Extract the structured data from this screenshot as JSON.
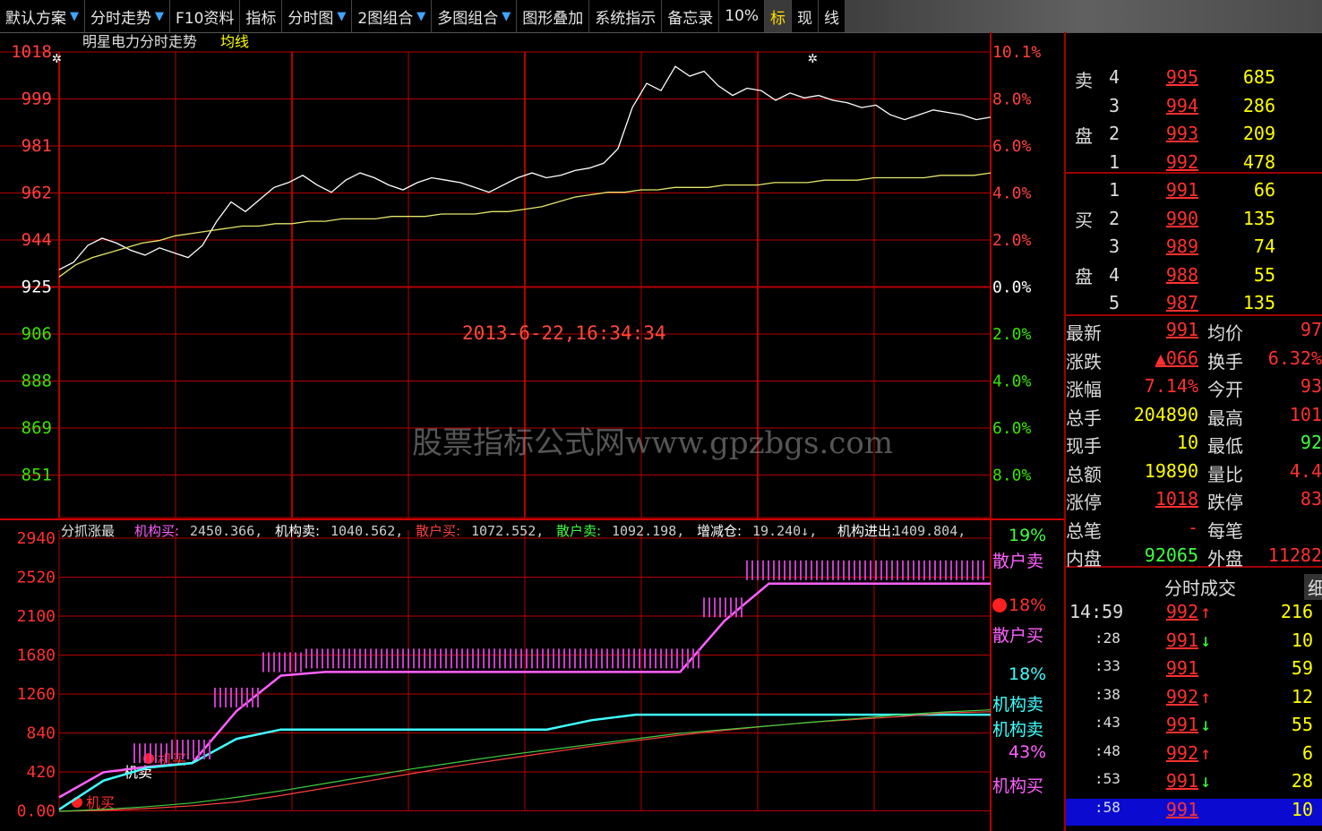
{
  "toolbar": {
    "items": [
      {
        "label": "默认方案",
        "arrow": true
      },
      {
        "label": "分时走势",
        "arrow": true
      },
      {
        "label": "F10资料",
        "arrow": false
      },
      {
        "label": "指标",
        "arrow": false
      },
      {
        "label": "分时图",
        "arrow": true
      },
      {
        "label": "2图组合",
        "arrow": true
      },
      {
        "label": "多图组合",
        "arrow": true
      },
      {
        "label": "图形叠加",
        "arrow": false
      },
      {
        "label": "系统指示",
        "arrow": false
      },
      {
        "label": "备忘录",
        "arrow": false
      },
      {
        "label": "10%",
        "arrow": false
      },
      {
        "label": "标",
        "arrow": false,
        "highlight": true
      },
      {
        "label": "现",
        "arrow": false
      },
      {
        "label": "线",
        "arrow": false
      }
    ]
  },
  "chart_header": {
    "title": "明星电力分时走势",
    "series_label": "均线"
  },
  "price_axis": {
    "left": [
      "1018",
      "999",
      "981",
      "962",
      "944",
      "925",
      "906",
      "888",
      "869",
      "851"
    ],
    "right": [
      "10.1%",
      "8.0%",
      "6.0%",
      "4.0%",
      "2.0%",
      "0.0%",
      "2.0%",
      "4.0%",
      "6.0%",
      "8.0%"
    ]
  },
  "timestamp": "2013-6-22,16:34:34",
  "watermark": "股票指标公式网www.gpzbgs.com",
  "indicator_header": {
    "name": "分抓涨最",
    "items": [
      {
        "label": "机构买:",
        "value": "2450.366,"
      },
      {
        "label": "机构卖:",
        "value": "1040.562,"
      },
      {
        "label": "散户买:",
        "value": "1072.552,"
      },
      {
        "label": "散户卖:",
        "value": "1092.198,"
      },
      {
        "label": "增减仓:",
        "value": "19.240↓,"
      },
      {
        "label": "机构进出:",
        "value": "1409.804,"
      }
    ]
  },
  "indicator_axis": [
    "2940",
    "2520",
    "2100",
    "1680",
    "1260",
    "840",
    "420",
    "0.00"
  ],
  "indicator_side": {
    "p1": "19%",
    "l1": "散户卖",
    "p2": "18%",
    "l2": "机构买",
    "l3": "散户买",
    "p3": "18%",
    "l4": "机构卖",
    "l5": "机构卖",
    "p4": "43%",
    "l6": "机构买"
  },
  "chart_labels": {
    "buy1": "机买",
    "sell1": "机卖",
    "buy2": "机买"
  },
  "orderbook": {
    "sell_label_1": "卖",
    "sell_label_2": "盘",
    "buy_label_1": "买",
    "buy_label_2": "盘",
    "sells": [
      {
        "level": "4",
        "price": "995",
        "vol": "685"
      },
      {
        "level": "3",
        "price": "994",
        "vol": "286"
      },
      {
        "level": "2",
        "price": "993",
        "vol": "209"
      },
      {
        "level": "1",
        "price": "992",
        "vol": "478"
      }
    ],
    "buys": [
      {
        "level": "1",
        "price": "991",
        "vol": "66"
      },
      {
        "level": "2",
        "price": "990",
        "vol": "135"
      },
      {
        "level": "3",
        "price": "989",
        "vol": "74"
      },
      {
        "level": "4",
        "price": "988",
        "vol": "55"
      },
      {
        "level": "5",
        "price": "987",
        "vol": "135"
      }
    ]
  },
  "quote": [
    {
      "l1": "最新",
      "v1": "991",
      "l2": "均价",
      "v2": "97"
    },
    {
      "l1": "涨跌",
      "v1": "▲066",
      "l2": "换手",
      "v2": "6.32%"
    },
    {
      "l1": "涨幅",
      "v1": "7.14%",
      "l2": "今开",
      "v2": "93"
    },
    {
      "l1": "总手",
      "v1": "204890",
      "l2": "最高",
      "v2": "101"
    },
    {
      "l1": "现手",
      "v1": "10",
      "l2": "最低",
      "v2": "92"
    },
    {
      "l1": "总额",
      "v1": "19890",
      "l2": "量比",
      "v2": "4.4"
    },
    {
      "l1": "涨停",
      "v1": "1018",
      "l2": "跌停",
      "v2": "83"
    },
    {
      "l1": "总笔",
      "v1": "-",
      "l2": "每笔",
      "v2": ""
    },
    {
      "l1": "内盘",
      "v1": "92065",
      "l2": "外盘",
      "v2": "11282"
    }
  ],
  "trades_header": {
    "title": "分时成交",
    "tab": "细"
  },
  "trades": [
    {
      "time": "14:59",
      "price": "992",
      "dir": "↑",
      "vol": "216"
    },
    {
      "time": ":28",
      "price": "991",
      "dir": "↓",
      "vol": "10"
    },
    {
      "time": ":33",
      "price": "991",
      "dir": "",
      "vol": "59"
    },
    {
      "time": ":38",
      "price": "992",
      "dir": "↑",
      "vol": "12"
    },
    {
      "time": ":43",
      "price": "991",
      "dir": "↓",
      "vol": "55"
    },
    {
      "time": ":48",
      "price": "992",
      "dir": "↑",
      "vol": "6"
    },
    {
      "time": ":53",
      "price": "991",
      "dir": "↓",
      "vol": "28"
    },
    {
      "time": ":58",
      "price": "991",
      "dir": "",
      "vol": "10"
    }
  ],
  "chart_data": {
    "type": "line",
    "ylim": [
      842,
      1018
    ],
    "series": [
      {
        "values": [
          928,
          931,
          938,
          941,
          939,
          936,
          934,
          937,
          935,
          933,
          938,
          948,
          956,
          952,
          957,
          962,
          964,
          967,
          963,
          960,
          965,
          968,
          966,
          963,
          961,
          964,
          966,
          965,
          964,
          962,
          960,
          963,
          966,
          968,
          966,
          967,
          969,
          970,
          972,
          978,
          995,
          1005,
          1002,
          1012,
          1008,
          1010,
          1004,
          1000,
          1003,
          1002,
          998,
          1001,
          999,
          1000,
          998,
          997,
          995,
          996,
          992,
          990,
          992,
          994,
          993,
          992,
          990,
          991
        ]
      },
      {
        "values": [
          925,
          930,
          933,
          935,
          937,
          939,
          940,
          942,
          943,
          944,
          945,
          946,
          946,
          947,
          947,
          948,
          948,
          949,
          949,
          949,
          950,
          950,
          950,
          951,
          951,
          951,
          952,
          952,
          953,
          954,
          956,
          958,
          959,
          960,
          960,
          961,
          961,
          962,
          962,
          962,
          963,
          963,
          963,
          964,
          964,
          964,
          965,
          965,
          965,
          966,
          966,
          966,
          966,
          967,
          967,
          967,
          968
        ]
      }
    ],
    "indicator": {
      "ylim": [
        0,
        2940
      ],
      "series": [
        {
          "values": [
            150,
            420,
            480,
            520,
            1080,
            1460,
            1500,
            1500,
            1500,
            1500,
            1500,
            1500,
            1500,
            1500,
            1500,
            2050,
            2450,
            2450,
            2450,
            2450,
            2450,
            2450
          ]
        },
        {
          "values": [
            20,
            330,
            470,
            520,
            780,
            880,
            880,
            880,
            880,
            880,
            880,
            880,
            980,
            1040,
            1040,
            1040,
            1040,
            1040,
            1040,
            1040,
            1040,
            1040
          ]
        },
        {
          "values": [
            0,
            10,
            30,
            60,
            100,
            170,
            250,
            330,
            410,
            490,
            560,
            630,
            700,
            760,
            820,
            870,
            920,
            960,
            990,
            1020,
            1060,
            1072
          ]
        },
        {
          "values": [
            0,
            20,
            50,
            90,
            150,
            220,
            300,
            380,
            460,
            530,
            600,
            660,
            720,
            780,
            840,
            880,
            920,
            960,
            1000,
            1040,
            1070,
            1092
          ]
        }
      ]
    }
  }
}
